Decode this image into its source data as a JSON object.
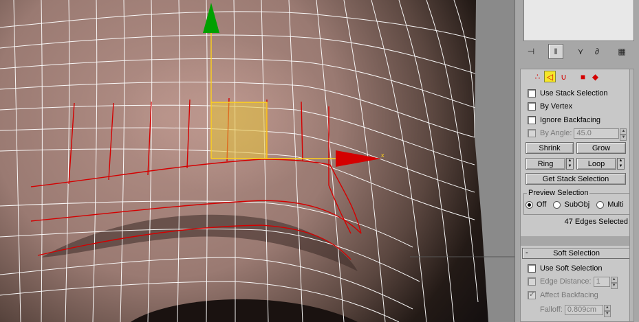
{
  "viewport": {
    "label": "3D viewport - perspective"
  },
  "command_panel": {
    "tabs": [
      {
        "name": "hierarchy-pin",
        "glyph": "⊣"
      },
      {
        "name": "stack-toggle",
        "glyph": "‖"
      },
      {
        "name": "show-end-result",
        "glyph": "⋎"
      },
      {
        "name": "make-unique",
        "glyph": "∂"
      },
      {
        "name": "configure-modifier-sets",
        "glyph": "▦"
      }
    ],
    "sub_object_levels": [
      {
        "name": "vertex-level",
        "glyph": "∴"
      },
      {
        "name": "edge-level",
        "glyph": "◁"
      },
      {
        "name": "border-level",
        "glyph": "∪"
      },
      {
        "name": "polygon-level",
        "glyph": "■"
      },
      {
        "name": "element-level",
        "glyph": "◆"
      }
    ],
    "selection": {
      "use_stack_selection": "Use Stack Selection",
      "by_vertex": "By Vertex",
      "ignore_backfacing": "Ignore Backfacing",
      "by_angle": "By Angle:",
      "by_angle_value": "45.0",
      "shrink": "Shrink",
      "grow": "Grow",
      "ring": "Ring",
      "loop": "Loop",
      "get_stack_selection": "Get Stack Selection",
      "preview_selection": {
        "title": "Preview Selection",
        "options": [
          "Off",
          "SubObj",
          "Multi"
        ],
        "selected": "Off"
      },
      "status": "47 Edges Selected"
    },
    "soft_selection": {
      "header": "Soft Selection",
      "collapse_glyph": "-",
      "use_soft_selection": "Use Soft Selection",
      "edge_distance": "Edge Distance:",
      "edge_distance_value": "1",
      "affect_backfacing": "Affect Backfacing",
      "falloff": "Falloff:",
      "falloff_value": "0.809cm"
    }
  },
  "colors": {
    "wire": "#ffffff",
    "selected_edge": "#d40000",
    "gizmo_x": "#d40000",
    "gizmo_y": "#00a000",
    "gizmo_plane": "#e6c23a",
    "panel_bg": "#c8c8c8"
  }
}
